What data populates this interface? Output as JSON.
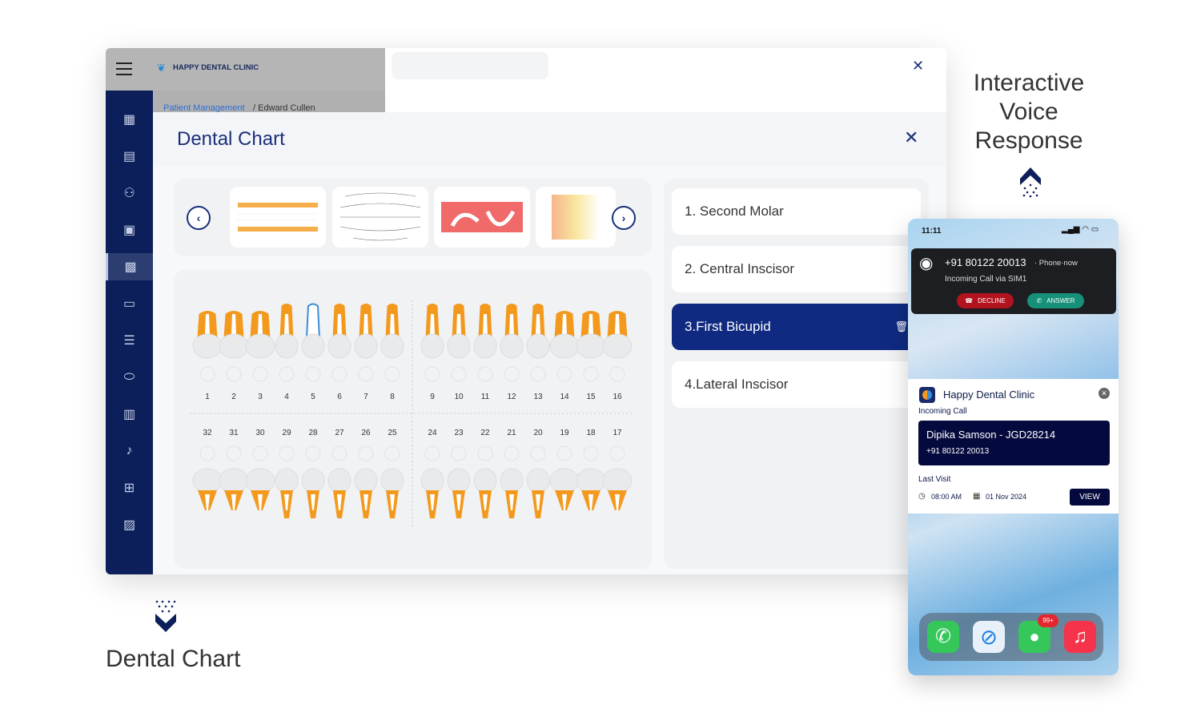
{
  "app": {
    "brand": "HAPPY DENTAL CLINIC",
    "breadcrumb_link": "Patient Management",
    "breadcrumb_current": " / Edward Cullen"
  },
  "sidebar": {
    "items": [
      {
        "icon": "dashboard-icon"
      },
      {
        "icon": "chat-icon"
      },
      {
        "icon": "user-settings-icon"
      },
      {
        "icon": "calendar-icon"
      },
      {
        "icon": "patient-clipboard-icon",
        "active": true
      },
      {
        "icon": "id-card-icon"
      },
      {
        "icon": "notes-icon"
      },
      {
        "icon": "pill-icon"
      },
      {
        "icon": "building-icon"
      },
      {
        "icon": "bell-icon"
      },
      {
        "icon": "message-add-icon"
      },
      {
        "icon": "gallery-icon"
      }
    ]
  },
  "modal": {
    "title": "Dental Chart",
    "close": "✕"
  },
  "chart": {
    "upper": [
      "1",
      "2",
      "3",
      "4",
      "5",
      "6",
      "7",
      "8",
      "9",
      "10",
      "11",
      "12",
      "13",
      "14",
      "15",
      "16"
    ],
    "lower": [
      "32",
      "31",
      "30",
      "29",
      "28",
      "27",
      "26",
      "25",
      "24",
      "23",
      "22",
      "21",
      "20",
      "19",
      "18",
      "17"
    ],
    "selected_tooth": "5",
    "colors": {
      "root": "#f39a1e",
      "crown": "#e9eaec",
      "selected": "#3a8fd8"
    }
  },
  "list": {
    "items": [
      {
        "label": "1. Second Molar"
      },
      {
        "label": "2. Central Inscisor"
      },
      {
        "label": "3.First Bicupid",
        "selected": true
      },
      {
        "label": "4.Lateral Inscisor"
      }
    ]
  },
  "phone": {
    "time": "11:11",
    "call_number": "+91 80122 20013",
    "call_meta": " · Phone·now",
    "call_sub": "Incoming Call via SIM1",
    "decline": "DECLINE",
    "answer": "ANSWER",
    "app_name": "Happy Dental Clinic",
    "incoming": "Incoming Call",
    "patient": "Dipika Samson - JGD28214",
    "patient_phone": "+91 80122 20013",
    "last_visit": "Last Visit",
    "visit_time": "08:00 AM",
    "visit_date": "01 Nov 2024",
    "view": "VIEW",
    "badge": "99+"
  },
  "captions": {
    "ivr": [
      "Interactive",
      "Voice",
      "Response"
    ],
    "dental": "Dental Chart"
  },
  "colors": {
    "navy": "#0c1f5a",
    "accent": "#0f2a80",
    "title": "#1a2f7a",
    "decline": "#b3121f",
    "answer": "#17907a"
  }
}
